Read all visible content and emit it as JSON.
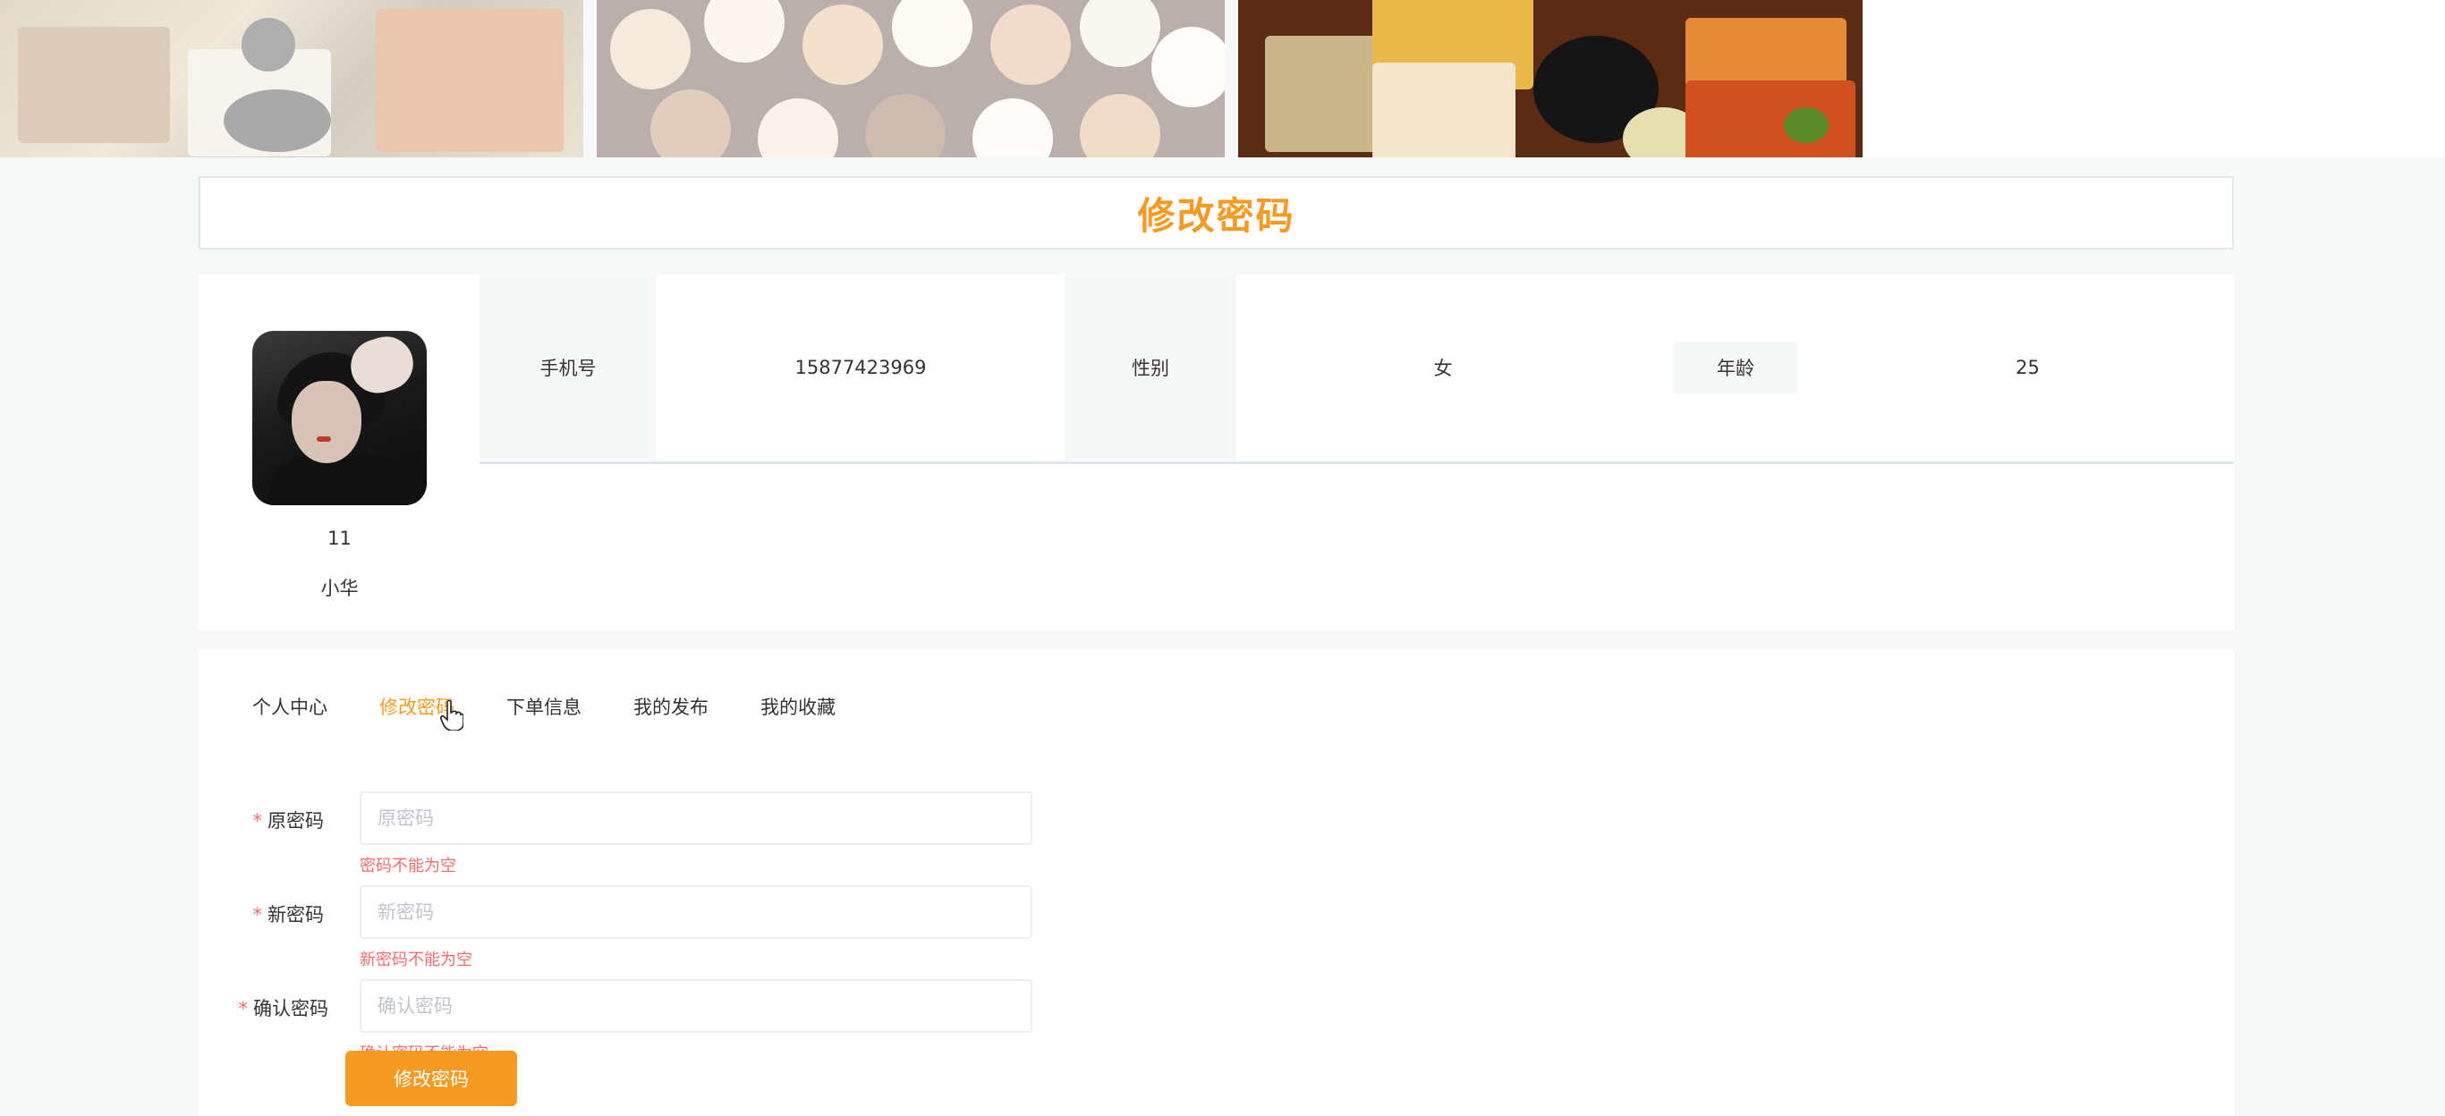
{
  "page": {
    "title": "修改密码"
  },
  "profile": {
    "id": "11",
    "name": "小华",
    "fields": {
      "phone_label": "手机号",
      "phone_value": "15877423969",
      "gender_label": "性别",
      "gender_value": "女",
      "age_label": "年龄",
      "age_value": "25"
    }
  },
  "tabs": [
    {
      "label": "个人中心"
    },
    {
      "label": "修改密码",
      "active": true
    },
    {
      "label": "下单信息"
    },
    {
      "label": "我的发布"
    },
    {
      "label": "我的收藏"
    }
  ],
  "form": {
    "old_password": {
      "label": "原密码",
      "placeholder": "原密码",
      "error": "密码不能为空"
    },
    "new_password": {
      "label": "新密码",
      "placeholder": "新密码",
      "error": "新密码不能为空"
    },
    "confirm_password": {
      "label": "确认密码",
      "placeholder": "确认密码",
      "error": "确认密码不能为空"
    },
    "required_mark": "*",
    "submit_label": "修改密码"
  },
  "colors": {
    "accent": "#f59a23",
    "error": "#f56c6c"
  }
}
